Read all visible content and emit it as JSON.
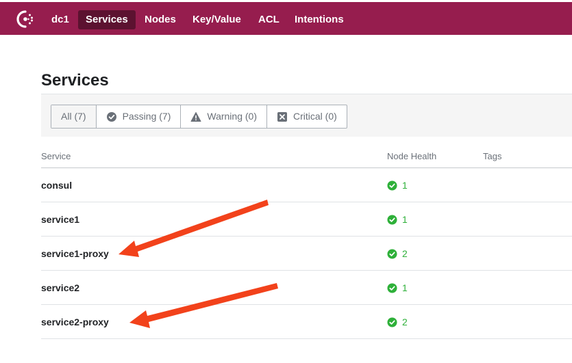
{
  "nav": {
    "logo_icon": "consul-logo-icon",
    "datacenter": "dc1",
    "items": [
      {
        "label": "Services",
        "active": true
      },
      {
        "label": "Nodes",
        "active": false
      },
      {
        "label": "Key/Value",
        "active": false
      },
      {
        "label": "ACL",
        "active": false
      },
      {
        "label": "Intentions",
        "active": false
      }
    ]
  },
  "page": {
    "title": "Services"
  },
  "filters": [
    {
      "label": "All (7)",
      "icon": null
    },
    {
      "label": "Passing (7)",
      "icon": "check-circle-icon"
    },
    {
      "label": "Warning (0)",
      "icon": "warning-triangle-icon"
    },
    {
      "label": "Critical (0)",
      "icon": "x-square-icon"
    }
  ],
  "table": {
    "headers": {
      "service": "Service",
      "health": "Node Health",
      "tags": "Tags"
    },
    "rows": [
      {
        "service": "consul",
        "health": "1"
      },
      {
        "service": "service1",
        "health": "1"
      },
      {
        "service": "service1-proxy",
        "health": "2"
      },
      {
        "service": "service2",
        "health": "1"
      },
      {
        "service": "service2-proxy",
        "health": "2"
      }
    ]
  },
  "colors": {
    "brand": "#961d4e",
    "nav_active": "#5c1230",
    "passing": "#2eb039",
    "annotation_arrow": "#f2421b"
  }
}
